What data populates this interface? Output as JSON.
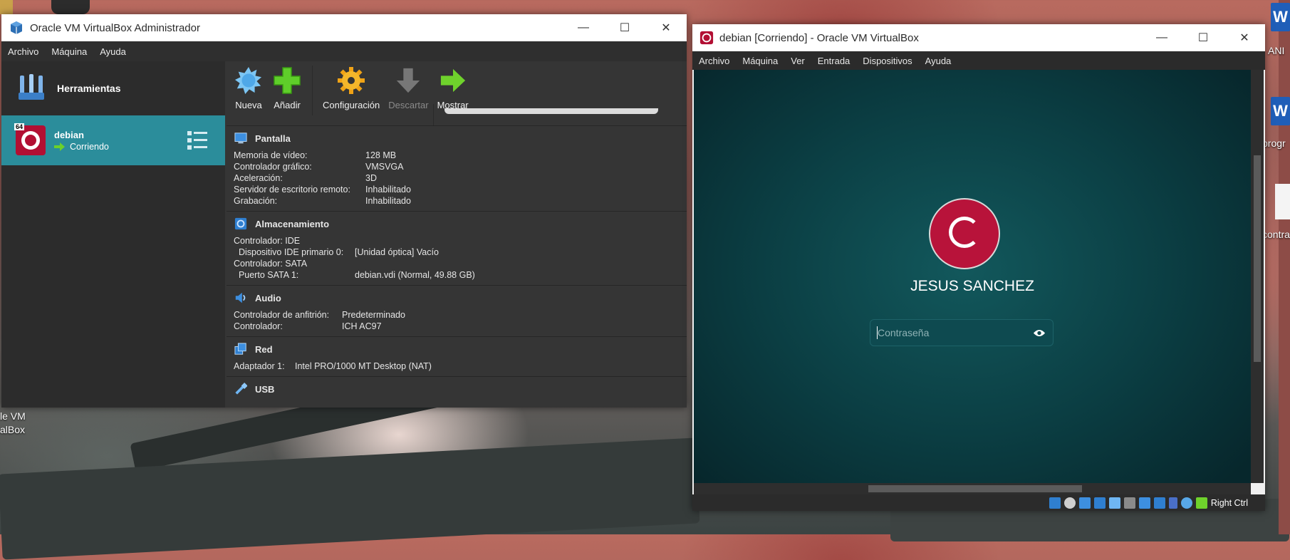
{
  "desktop": {
    "left_labels": [
      "le VM",
      "alBox"
    ],
    "right_labels": [
      "ANI",
      "progr",
      "contra"
    ],
    "word_icon_letter": "W"
  },
  "manager": {
    "title": "Oracle VM VirtualBox Administrador",
    "menu": [
      "Archivo",
      "Máquina",
      "Ayuda"
    ],
    "tools_label": "Herramientas",
    "vm": {
      "name": "debian",
      "state": "Corriendo",
      "badge": "64"
    },
    "toolbar": [
      {
        "label": "Nueva",
        "icon": "new-star-icon",
        "enabled": true
      },
      {
        "label": "Añadir",
        "icon": "add-plus-icon",
        "enabled": true
      },
      {
        "label": "Configuración",
        "icon": "settings-gear-icon",
        "enabled": true
      },
      {
        "label": "Descartar",
        "icon": "discard-arrow-icon",
        "enabled": false
      },
      {
        "label": "Mostrar",
        "icon": "show-arrow-icon",
        "enabled": true
      }
    ],
    "sections": {
      "display": {
        "title": "Pantalla",
        "rows": [
          {
            "k": "Memoria de vídeo:",
            "v": "128 MB"
          },
          {
            "k": "Controlador gráfico:",
            "v": "VMSVGA"
          },
          {
            "k": "Aceleración:",
            "v": "3D"
          },
          {
            "k": "Servidor de escritorio remoto:",
            "v": "Inhabilitado"
          },
          {
            "k": "Grabación:",
            "v": "Inhabilitado"
          }
        ]
      },
      "storage": {
        "title": "Almacenamiento",
        "rows": [
          {
            "k": "Controlador: IDE",
            "v": ""
          },
          {
            "k": "  Dispositivo IDE primario 0:",
            "v": "[Unidad óptica] Vacío"
          },
          {
            "k": "Controlador: SATA",
            "v": ""
          },
          {
            "k": "  Puerto SATA 1:",
            "v": "debian.vdi (Normal, 49.88 GB)"
          }
        ]
      },
      "audio": {
        "title": "Audio",
        "rows": [
          {
            "k": "Controlador de anfitrión:",
            "v": "Predeterminado"
          },
          {
            "k": "Controlador:",
            "v": "ICH AC97"
          }
        ]
      },
      "network": {
        "title": "Red",
        "rows": [
          {
            "k": "Adaptador 1:",
            "v": "Intel PRO/1000 MT Desktop (NAT)"
          }
        ]
      },
      "usb": {
        "title": "USB"
      }
    }
  },
  "vmwindow": {
    "title": "debian [Corriendo] - Oracle VM VirtualBox",
    "menu": [
      "Archivo",
      "Máquina",
      "Ver",
      "Entrada",
      "Dispositivos",
      "Ayuda"
    ],
    "login": {
      "user": "JESUS SANCHEZ",
      "password_placeholder": "Contraseña"
    },
    "host_key": "Right Ctrl"
  },
  "window_controls": {
    "minimize": "—",
    "maximize": "☐",
    "close": "✕"
  }
}
